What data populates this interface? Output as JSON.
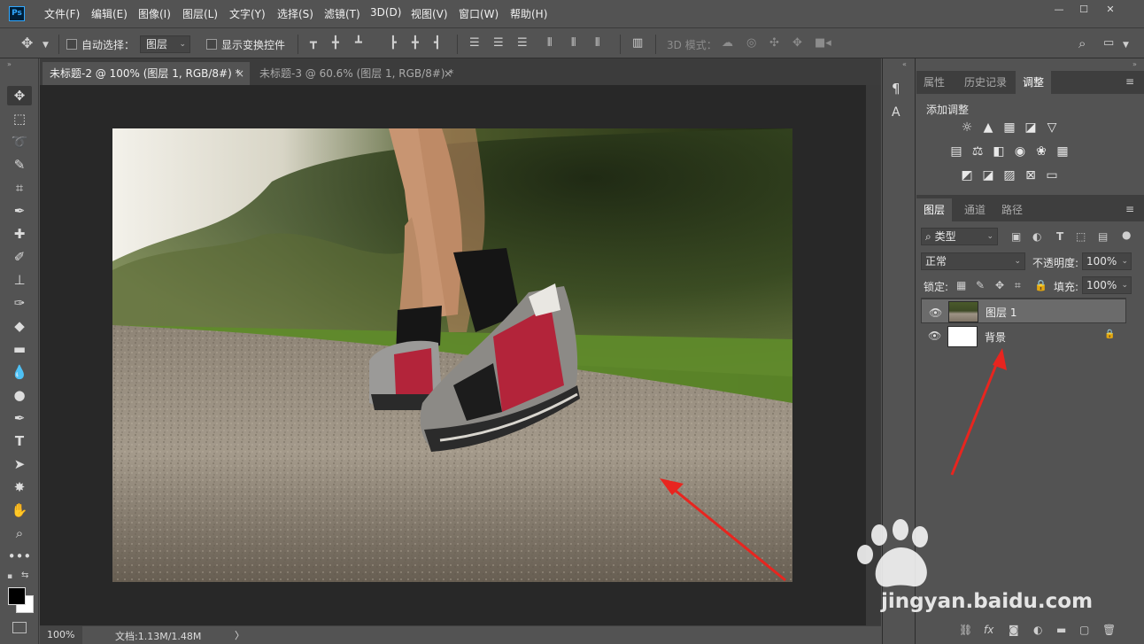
{
  "app": {
    "logo": "Ps"
  },
  "menu": [
    "文件(F)",
    "编辑(E)",
    "图像(I)",
    "图层(L)",
    "文字(Y)",
    "选择(S)",
    "滤镜(T)",
    "3D(D)",
    "视图(V)",
    "窗口(W)",
    "帮助(H)"
  ],
  "window_controls": {
    "minimize": "—",
    "maximize": "☐",
    "close": "✕"
  },
  "options": {
    "auto_select_label": "自动选择：",
    "auto_select_value": "图层",
    "transform_label": "显示变换控件",
    "mode3d_label": "3D 模式："
  },
  "tabs": [
    {
      "title": "未标题-2 @ 100% (图层 1, RGB/8#) *",
      "close": "×"
    },
    {
      "title": "未标题-3 @ 60.6% (图层 1, RGB/8#) *",
      "close": "×"
    }
  ],
  "status": {
    "zoom": "100%",
    "doc": "文档:1.13M/1.48M",
    "arrow": "〉"
  },
  "top_panel": {
    "tabs": [
      "属性",
      "历史记录",
      "调整"
    ],
    "add_adjustment": "添加调整"
  },
  "layers_panel": {
    "tabs": [
      "图层",
      "通道",
      "路径"
    ],
    "kind_label": "类型",
    "blend_mode": "正常",
    "opacity_label": "不透明度:",
    "opacity": "100%",
    "lock_label": "锁定:",
    "fill_label": "填充:",
    "fill": "100%",
    "layers": [
      {
        "name": "图层 1",
        "selected": true
      },
      {
        "name": "背景",
        "selected": false,
        "locked": true
      }
    ]
  },
  "watermark": {
    "text": "jingyan.baidu.com"
  },
  "colors": {
    "accent_arrow": "#e8251f",
    "panel_bg": "#535353",
    "canvas_bg": "#282828"
  }
}
